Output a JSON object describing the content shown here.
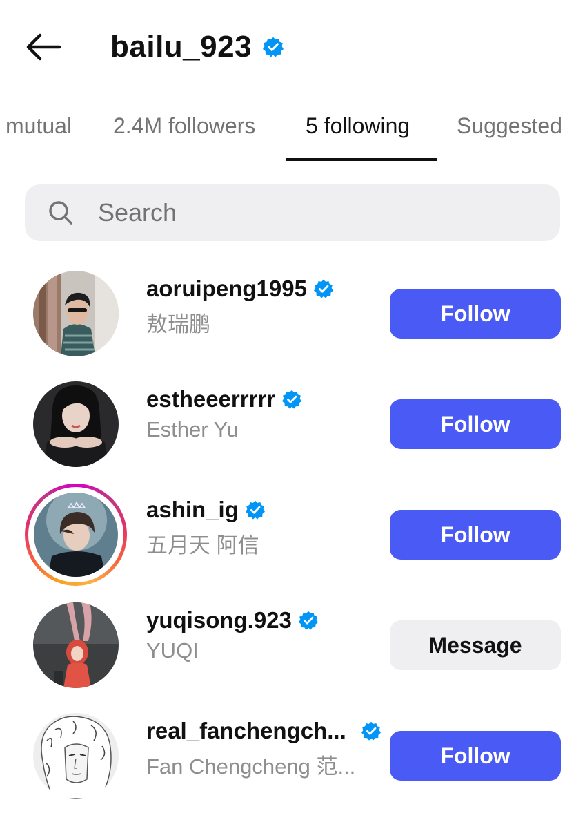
{
  "header": {
    "title": "bailu_923",
    "back_icon": "arrow-left-icon",
    "verified_icon": "verified-badge-icon"
  },
  "tabs": [
    {
      "label": "mutual",
      "active": false
    },
    {
      "label": "2.4M followers",
      "active": false
    },
    {
      "label": "5 following",
      "active": true
    },
    {
      "label": "Suggested",
      "active": false
    }
  ],
  "search": {
    "placeholder": "Search",
    "value": "",
    "icon": "search-icon"
  },
  "users": [
    {
      "username": "aoruipeng1995",
      "fullname": "敖瑞鹏",
      "verified": true,
      "button": "Follow",
      "button_style": "follow",
      "story_ring": false
    },
    {
      "username": "estheeerrrrr",
      "fullname": "Esther Yu",
      "verified": true,
      "button": "Follow",
      "button_style": "follow",
      "story_ring": false
    },
    {
      "username": "ashin_ig",
      "fullname": "五月天 阿信",
      "verified": true,
      "button": "Follow",
      "button_style": "follow",
      "story_ring": true
    },
    {
      "username": "yuqisong.923",
      "fullname": "YUQI",
      "verified": true,
      "button": "Message",
      "button_style": "message",
      "story_ring": false
    },
    {
      "username": "real_fanchengch...",
      "fullname": "Fan Chengcheng 范...",
      "verified": true,
      "button": "Follow",
      "button_style": "follow",
      "story_ring": false
    }
  ],
  "colors": {
    "accent": "#4a5af5",
    "verified": "#0095f6",
    "muted_text": "#737373",
    "secondary_text": "#8e8e8e",
    "message_bg": "#efeff1"
  }
}
